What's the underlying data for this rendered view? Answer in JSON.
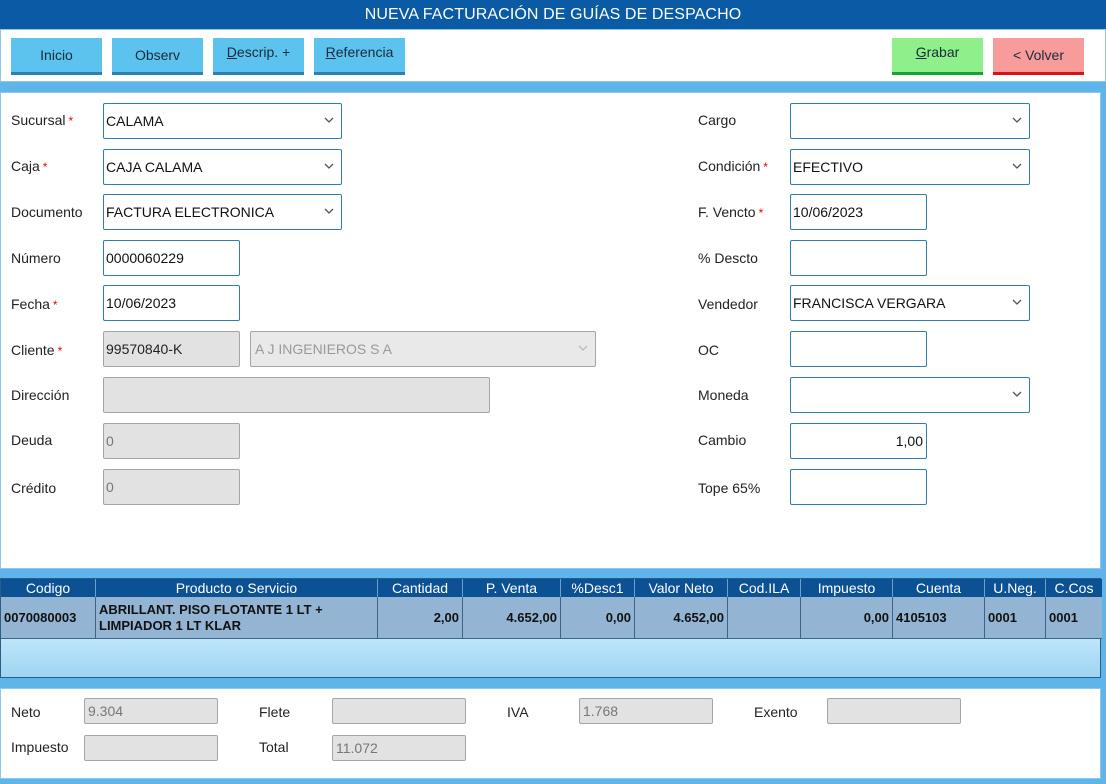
{
  "window": {
    "title": "NUEVA FACTURACIÓN DE GUÍAS DE DESPACHO"
  },
  "toolbar": {
    "inicio": "Inicio",
    "observ": "Observ",
    "descrip_u": "D",
    "descrip_rest": "escrip. +",
    "referencia_u": "R",
    "referencia_rest": "eferencia",
    "grabar_u": "G",
    "grabar_rest": "rabar",
    "volver": "< Volver"
  },
  "form": {
    "sucursal": {
      "label": "Sucursal",
      "value": "CALAMA"
    },
    "caja": {
      "label": "Caja",
      "value": "CAJA CALAMA"
    },
    "documento": {
      "label": "Documento",
      "value": "FACTURA ELECTRONICA"
    },
    "numero": {
      "label": "Número",
      "value": "0000060229"
    },
    "fecha": {
      "label": "Fecha",
      "value": "10/06/2023"
    },
    "cliente": {
      "label": "Cliente",
      "rut": "99570840-K",
      "name": "A J INGENIEROS S A"
    },
    "direccion": {
      "label": "Dirección",
      "value": ""
    },
    "deuda": {
      "label": "Deuda",
      "value": "0"
    },
    "credito": {
      "label": "Crédito",
      "value": "0"
    },
    "cargo": {
      "label": "Cargo",
      "value": ""
    },
    "condicion": {
      "label": "Condición",
      "value": "EFECTIVO"
    },
    "fvencto": {
      "label": "F. Vencto",
      "value": "10/06/2023"
    },
    "descto": {
      "label": "% Descto",
      "value": ""
    },
    "vendedor": {
      "label": "Vendedor",
      "value": "FRANCISCA VERGARA"
    },
    "oc": {
      "label": "OC",
      "value": ""
    },
    "moneda": {
      "label": "Moneda",
      "value": ""
    },
    "cambio": {
      "label": "Cambio",
      "value": "1,00"
    },
    "tope": {
      "label": "Tope 65%",
      "value": ""
    },
    "required_mark": "*"
  },
  "grid": {
    "headers": [
      "Codigo",
      "Producto o Servicio",
      "Cantidad",
      "P. Venta",
      "%Desc1",
      "Valor Neto",
      "Cod.ILA",
      "Impuesto",
      "Cuenta",
      "U.Neg.",
      "C.Cos"
    ],
    "rows": [
      {
        "codigo": "0070080003",
        "producto": "ABRILLANT. PISO FLOTANTE 1 LT + LIMPIADOR 1 LT KLAR",
        "cantidad": "2,00",
        "pventa": "4.652,00",
        "desc1": "0,00",
        "valorneto": "4.652,00",
        "codila": "",
        "impuesto": "0,00",
        "cuenta": "4105103",
        "uneg": "0001",
        "ccos": "0001"
      }
    ]
  },
  "totals": {
    "neto": {
      "label": "Neto",
      "value": "9.304"
    },
    "flete": {
      "label": "Flete",
      "value": ""
    },
    "iva": {
      "label": "IVA",
      "value": "1.768"
    },
    "exento": {
      "label": "Exento",
      "value": ""
    },
    "impuesto": {
      "label": "Impuesto",
      "value": ""
    },
    "total": {
      "label": "Total",
      "value": "11.072"
    }
  }
}
